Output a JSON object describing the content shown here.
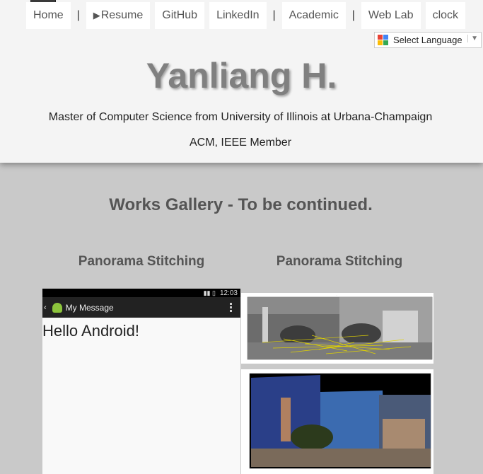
{
  "nav": {
    "items": [
      "Home",
      "Resume",
      "GitHub",
      "LinkedIn",
      "Academic",
      "Web Lab",
      "clock"
    ],
    "separator": "|"
  },
  "language": {
    "label": "Select Language"
  },
  "header": {
    "title": "Yanliang H.",
    "subtitle": "Master of Computer Science from University of Illinois at Urbana-Champaign",
    "membership": "ACM, IEEE Member"
  },
  "gallery": {
    "title": "Works Gallery - To be continued.",
    "items": [
      {
        "caption": "Panorama Stitching"
      },
      {
        "caption": "Panorama Stitching"
      }
    ]
  },
  "phone": {
    "time": "12:03",
    "app_title": "My Message",
    "body": "Hello Android!"
  },
  "colors": {
    "header_bg": "#f4f4f4",
    "page_bg": "#c9c9c9",
    "accent_green": "#8cc43c"
  }
}
